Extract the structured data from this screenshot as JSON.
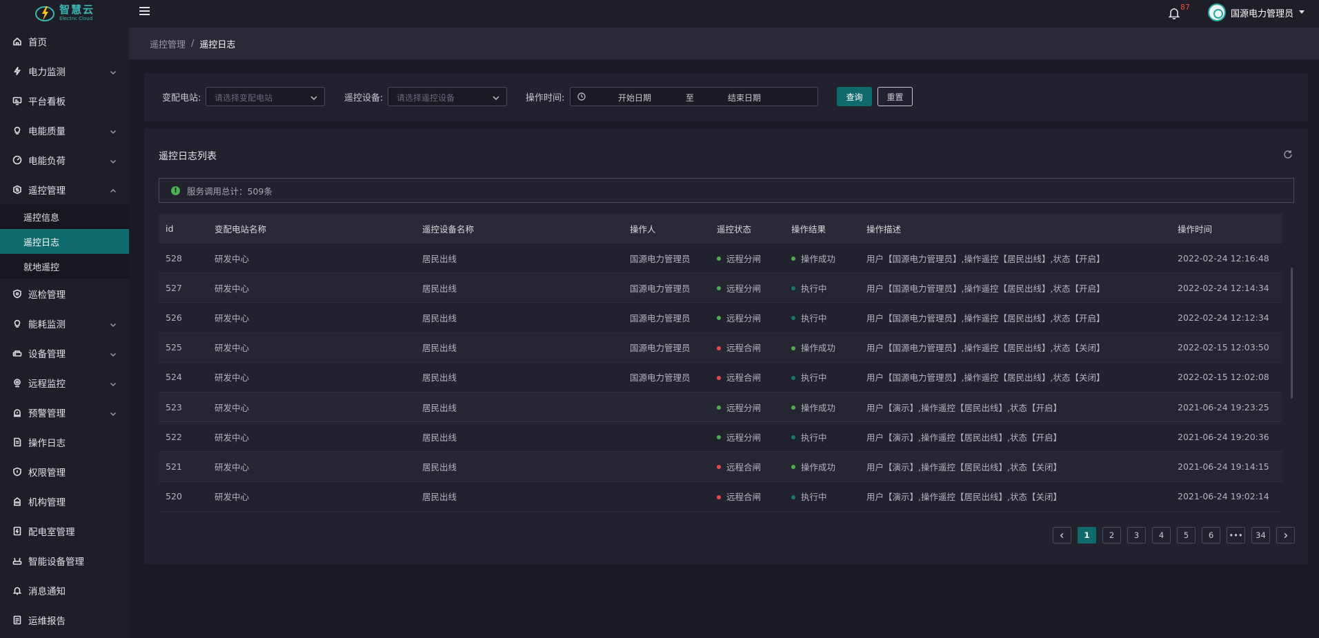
{
  "app": {
    "logo_cn": "智慧云",
    "logo_en": "Electric Cloud"
  },
  "header": {
    "notification_count": "87",
    "username": "国源电力管理员"
  },
  "sidebar": {
    "items": [
      {
        "label": "首页",
        "icon": "home-icon",
        "has_children": false
      },
      {
        "label": "电力监测",
        "icon": "lightning-icon",
        "has_children": true
      },
      {
        "label": "平台看板",
        "icon": "monitor-icon",
        "has_children": false
      },
      {
        "label": "电能质量",
        "icon": "bulb-icon",
        "has_children": true
      },
      {
        "label": "电能负荷",
        "icon": "gauge-icon",
        "has_children": true
      },
      {
        "label": "遥控管理",
        "icon": "remote-icon",
        "has_children": true,
        "expanded": true
      },
      {
        "label": "巡检管理",
        "icon": "inspect-icon",
        "has_children": false
      },
      {
        "label": "能耗监测",
        "icon": "bulb-icon",
        "has_children": true
      },
      {
        "label": "设备管理",
        "icon": "device-icon",
        "has_children": true
      },
      {
        "label": "远程监控",
        "icon": "camera-icon",
        "has_children": true
      },
      {
        "label": "预警管理",
        "icon": "alarm-icon",
        "has_children": true
      },
      {
        "label": "操作日志",
        "icon": "document-icon",
        "has_children": false
      },
      {
        "label": "权限管理",
        "icon": "shield-icon",
        "has_children": false
      },
      {
        "label": "机构管理",
        "icon": "building-icon",
        "has_children": false
      },
      {
        "label": "配电室管理",
        "icon": "plug-icon",
        "has_children": false
      },
      {
        "label": "智能设备管理",
        "icon": "router-icon",
        "has_children": false
      },
      {
        "label": "消息通知",
        "icon": "bell-icon",
        "has_children": false
      },
      {
        "label": "运维报告",
        "icon": "report-icon",
        "has_children": false
      }
    ],
    "remote_sub": [
      {
        "label": "遥控信息",
        "active": false
      },
      {
        "label": "遥控日志",
        "active": true
      },
      {
        "label": "就地遥控",
        "active": false
      }
    ]
  },
  "breadcrumb": {
    "parent": "遥控管理",
    "separator": "/",
    "current": "遥控日志"
  },
  "filter": {
    "station_label": "变配电站:",
    "station_placeholder": "请选择变配电站",
    "device_label": "遥控设备:",
    "device_placeholder": "请选择遥控设备",
    "time_label": "操作时间:",
    "start_placeholder": "开始日期",
    "range_sep": "至",
    "end_placeholder": "结束日期",
    "query_button": "查询",
    "reset_button": "重置"
  },
  "list": {
    "title": "遥控日志列表",
    "summary": "服务调用总计：509条",
    "columns": [
      "id",
      "变配电站名称",
      "遥控设备名称",
      "操作人",
      "遥控状态",
      "操作结果",
      "操作描述",
      "操作时间"
    ],
    "rows": [
      {
        "id": "528",
        "station": "研发中心",
        "device": "居民出线",
        "operator": "国源电力管理员",
        "rstate": "远程分闸",
        "rstate_color": "#4caf50",
        "result": "操作成功",
        "result_color": "#4caf50",
        "desc": "用户【国源电力管理员】,操作遥控【居民出线】,状态【开启】",
        "time": "2022-02-24 12:16:48"
      },
      {
        "id": "527",
        "station": "研发中心",
        "device": "居民出线",
        "operator": "国源电力管理员",
        "rstate": "远程分闸",
        "rstate_color": "#4caf50",
        "result": "执行中",
        "result_color": "#1a7a6a",
        "desc": "用户【国源电力管理员】,操作遥控【居民出线】,状态【开启】",
        "time": "2022-02-24 12:14:34"
      },
      {
        "id": "526",
        "station": "研发中心",
        "device": "居民出线",
        "operator": "国源电力管理员",
        "rstate": "远程分闸",
        "rstate_color": "#4caf50",
        "result": "执行中",
        "result_color": "#1a7a6a",
        "desc": "用户【国源电力管理员】,操作遥控【居民出线】,状态【开启】",
        "time": "2022-02-24 12:12:34"
      },
      {
        "id": "525",
        "station": "研发中心",
        "device": "居民出线",
        "operator": "国源电力管理员",
        "rstate": "远程合闸",
        "rstate_color": "#e84a4a",
        "result": "操作成功",
        "result_color": "#4caf50",
        "desc": "用户【国源电力管理员】,操作遥控【居民出线】,状态【关闭】",
        "time": "2022-02-15 12:03:50"
      },
      {
        "id": "524",
        "station": "研发中心",
        "device": "居民出线",
        "operator": "国源电力管理员",
        "rstate": "远程合闸",
        "rstate_color": "#e84a4a",
        "result": "执行中",
        "result_color": "#1a7a6a",
        "desc": "用户【国源电力管理员】,操作遥控【居民出线】,状态【关闭】",
        "time": "2022-02-15 12:02:08"
      },
      {
        "id": "523",
        "station": "研发中心",
        "device": "居民出线",
        "operator": "",
        "rstate": "远程分闸",
        "rstate_color": "#4caf50",
        "result": "操作成功",
        "result_color": "#4caf50",
        "desc": "用户【演示】,操作遥控【居民出线】,状态【开启】",
        "time": "2021-06-24 19:23:25"
      },
      {
        "id": "522",
        "station": "研发中心",
        "device": "居民出线",
        "operator": "",
        "rstate": "远程分闸",
        "rstate_color": "#4caf50",
        "result": "执行中",
        "result_color": "#1a7a6a",
        "desc": "用户【演示】,操作遥控【居民出线】,状态【开启】",
        "time": "2021-06-24 19:20:36"
      },
      {
        "id": "521",
        "station": "研发中心",
        "device": "居民出线",
        "operator": "",
        "rstate": "远程合闸",
        "rstate_color": "#e84a4a",
        "result": "操作成功",
        "result_color": "#4caf50",
        "desc": "用户【演示】,操作遥控【居民出线】,状态【关闭】",
        "time": "2021-06-24 19:14:15"
      },
      {
        "id": "520",
        "station": "研发中心",
        "device": "居民出线",
        "operator": "",
        "rstate": "远程合闸",
        "rstate_color": "#e84a4a",
        "result": "执行中",
        "result_color": "#1a7a6a",
        "desc": "用户【演示】,操作遥控【居民出线】,状态【关闭】",
        "time": "2021-06-24 19:02:14"
      }
    ]
  },
  "pagination": {
    "pages": [
      "1",
      "2",
      "3",
      "4",
      "5",
      "6",
      "•••",
      "34"
    ],
    "current": "1"
  }
}
